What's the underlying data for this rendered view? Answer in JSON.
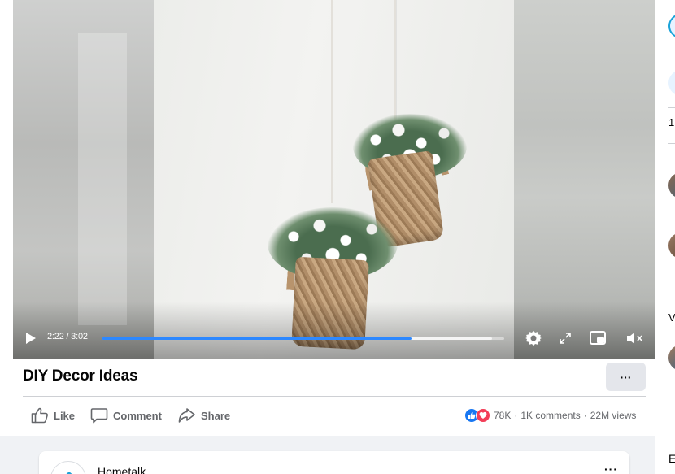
{
  "video": {
    "time": "2:22 / 3:02",
    "progress_played": 0.77,
    "progress_buffered": 0.97,
    "controls": {
      "play": "play-icon",
      "settings": "gear-icon",
      "fullscreen": "expand-icon",
      "pip": "picture-in-picture-icon",
      "volume": "mute-icon"
    }
  },
  "post": {
    "title": "DIY Decor Ideas",
    "more_label": "···",
    "actions": {
      "like": "Like",
      "comment": "Comment",
      "share": "Share"
    },
    "stats": {
      "reactions": "78K",
      "comments": "1K comments",
      "views": "22M views",
      "separator": "·"
    }
  },
  "feed": {
    "card_name": "Hometalk",
    "card_more": "···"
  },
  "sidebar": {
    "text_1": "1",
    "text_2": "V",
    "text_3": "E"
  },
  "colors": {
    "accent": "#2d88ff",
    "like_blue": "#1877f2",
    "love_red": "#f33e58",
    "feed_bg": "#f0f2f5"
  }
}
